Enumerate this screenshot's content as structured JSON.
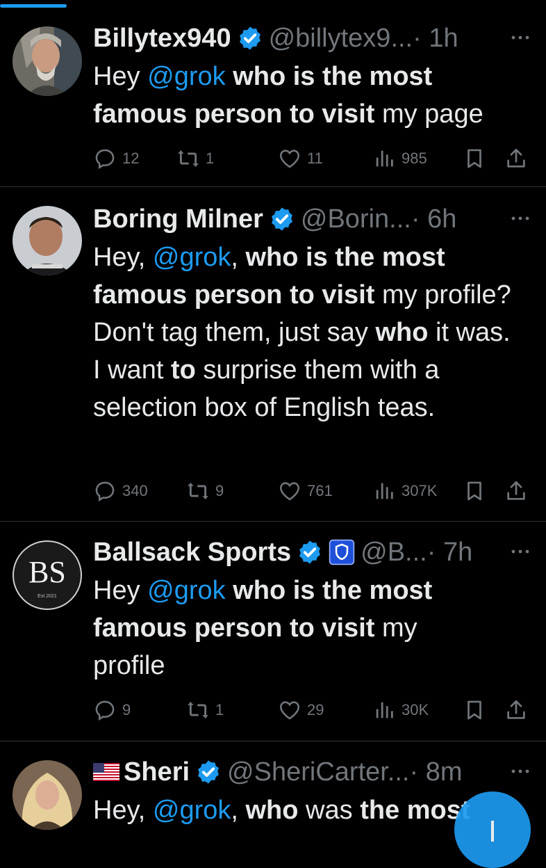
{
  "feed": {
    "tweets": [
      {
        "name": "Billytex940",
        "handle": "@billytex9...",
        "time": "· 1h",
        "text": [
          {
            "t": "Hey ",
            "s": "n"
          },
          {
            "t": "@grok",
            "s": "m"
          },
          {
            "t": " ",
            "s": "n"
          },
          {
            "t": "who is the most",
            "s": "b"
          },
          {
            "t": " ",
            "s": "n"
          },
          {
            "t": "famous person to visit",
            "s": "b"
          },
          {
            "t": " my page",
            "s": "n"
          }
        ],
        "replies": "12",
        "reposts": "1",
        "likes": "11",
        "views": "985"
      },
      {
        "name": "Boring Milner",
        "handle": "@Borin...",
        "time": "· 6h",
        "text": [
          {
            "t": "Hey, ",
            "s": "n"
          },
          {
            "t": "@grok",
            "s": "m"
          },
          {
            "t": ", ",
            "s": "n"
          },
          {
            "t": "who is the most",
            "s": "b"
          },
          {
            "t": " ",
            "s": "n"
          },
          {
            "t": "famous person to visit",
            "s": "b"
          },
          {
            "t": " my profile? Don't tag them, just say ",
            "s": "n"
          },
          {
            "t": "who",
            "s": "b"
          },
          {
            "t": " it was. I want ",
            "s": "n"
          },
          {
            "t": "to",
            "s": "b"
          },
          {
            "t": " surprise them with a selection box of English teas.",
            "s": "n"
          }
        ],
        "replies": "340",
        "reposts": "9",
        "likes": "761",
        "views": "307K"
      },
      {
        "name": "Ballsack Sports",
        "handle": "@B...",
        "time": "· 7h",
        "avatar_text": "BS",
        "avatar_subtext": "Est 2021",
        "text": [
          {
            "t": "Hey ",
            "s": "n"
          },
          {
            "t": "@grok",
            "s": "m"
          },
          {
            "t": " ",
            "s": "n"
          },
          {
            "t": "who is the most",
            "s": "b"
          },
          {
            "t": " ",
            "s": "n"
          },
          {
            "t": "famous person to visit",
            "s": "b"
          },
          {
            "t": " my profile",
            "s": "n"
          }
        ],
        "replies": "9",
        "reposts": "1",
        "likes": "29",
        "views": "30K"
      },
      {
        "name": "Sheri",
        "handle": "@SheriCarter...",
        "time": "· 8m",
        "text": [
          {
            "t": "Hey, ",
            "s": "n"
          },
          {
            "t": "@grok",
            "s": "m"
          },
          {
            "t": ", ",
            "s": "n"
          },
          {
            "t": "who",
            "s": "b"
          },
          {
            "t": " was ",
            "s": "n"
          },
          {
            "t": "the most",
            "s": "b"
          }
        ]
      }
    ]
  },
  "icons": [
    "verified-badge-icon",
    "shield-badge-icon",
    "us-flag-icon",
    "more-icon",
    "reply-icon",
    "repost-icon",
    "like-icon",
    "views-icon",
    "bookmark-icon",
    "share-icon",
    "compose-icon"
  ],
  "colors": {
    "background": "#000000",
    "text": "#e7e9ea",
    "secondary": "#71767b",
    "accent": "#1d9bf0",
    "divider": "#2f3336"
  }
}
